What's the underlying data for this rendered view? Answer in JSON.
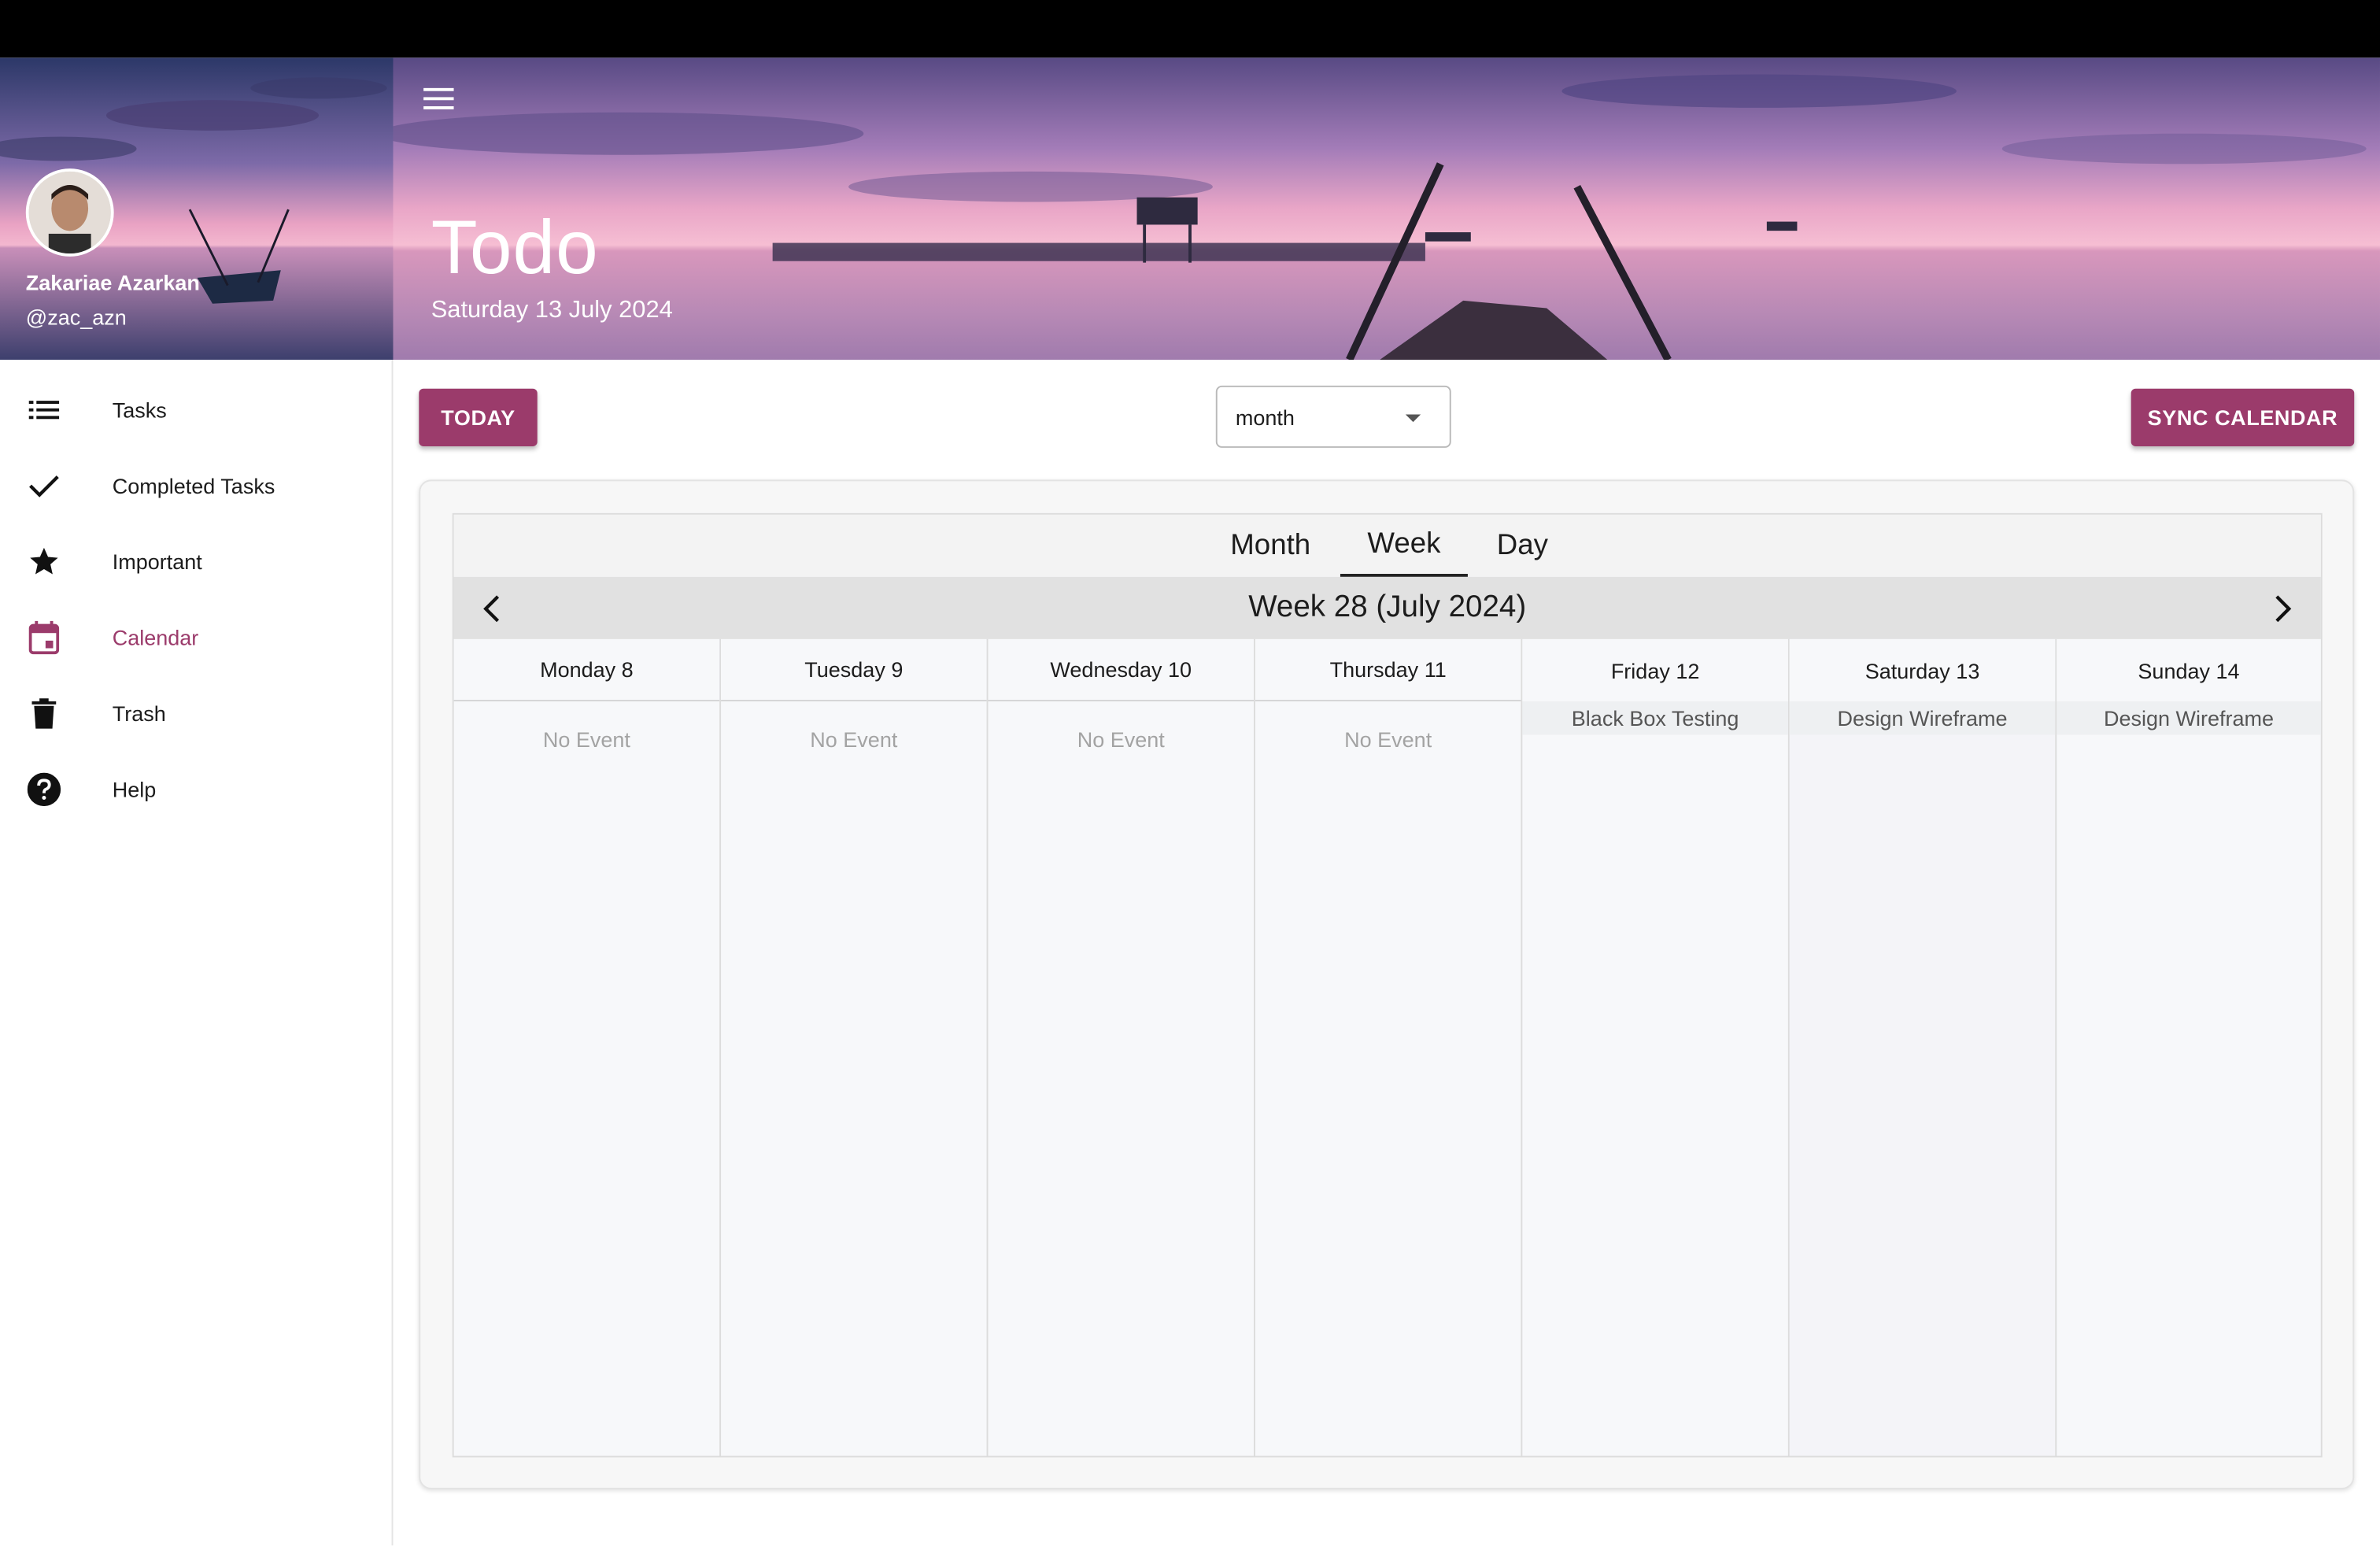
{
  "profile": {
    "name": "Zakariae Azarkan",
    "handle": "@zac_azn"
  },
  "header": {
    "title": "Todo",
    "date": "Saturday 13 July 2024"
  },
  "sidebar": {
    "items": [
      {
        "label": "Tasks",
        "icon": "list-icon",
        "active": false
      },
      {
        "label": "Completed Tasks",
        "icon": "check-icon",
        "active": false
      },
      {
        "label": "Important",
        "icon": "star-icon",
        "active": false
      },
      {
        "label": "Calendar",
        "icon": "calendar-icon",
        "active": true
      },
      {
        "label": "Trash",
        "icon": "trash-icon",
        "active": false
      },
      {
        "label": "Help",
        "icon": "help-icon",
        "active": false
      }
    ]
  },
  "toolbar": {
    "today_label": "TODAY",
    "view_select_value": "month",
    "sync_label": "SYNC CALENDAR"
  },
  "calendar": {
    "tabs": [
      {
        "label": "Month",
        "active": false
      },
      {
        "label": "Week",
        "active": true
      },
      {
        "label": "Day",
        "active": false
      }
    ],
    "week_title": "Week 28 (July 2024)",
    "days": [
      {
        "label": "Monday 8",
        "event": "",
        "empty_text": "No Event"
      },
      {
        "label": "Tuesday 9",
        "event": "",
        "empty_text": "No Event"
      },
      {
        "label": "Wednesday 10",
        "event": "",
        "empty_text": "No Event"
      },
      {
        "label": "Thursday 11",
        "event": "",
        "empty_text": "No Event"
      },
      {
        "label": "Friday 12",
        "event": "Black Box Testing",
        "empty_text": ""
      },
      {
        "label": "Saturday 13",
        "event": "Design Wireframe",
        "empty_text": ""
      },
      {
        "label": "Sunday 14",
        "event": "Design Wireframe",
        "empty_text": ""
      }
    ]
  },
  "colors": {
    "accent": "#9b3b6b",
    "top_bar": "#000000",
    "calendar_bg": "#f7f8fa"
  }
}
